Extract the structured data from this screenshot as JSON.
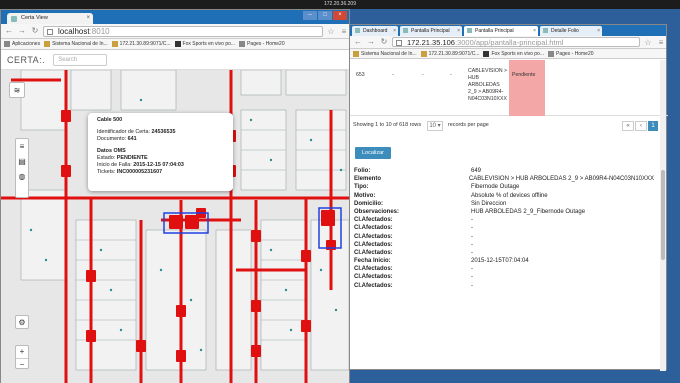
{
  "system": {
    "top_label": "172.20.36.209"
  },
  "left_window": {
    "tab_title": "Certa View",
    "url_host": "localhost",
    "url_port": ":8010",
    "bookmarks": [
      "Aplicaciones",
      "Sistema Nacional de In...",
      "172.21.30.89:9071/C...",
      "Fox Sports en vivo po...",
      "Pages - Home20"
    ],
    "app_logo": "CERTA:.",
    "search_placeholder": "Search",
    "popup": {
      "title": "Cable 500",
      "id_label": "Identificador de Certa:",
      "id_value": "24536535",
      "doc_label": "Documento:",
      "doc_value": "641",
      "section": "Datos OMS",
      "estado_label": "Estado:",
      "estado_value": "PENDIENTE",
      "inicio_label": "Inicio de Falla:",
      "inicio_value": "2015-12-15 07:04:03",
      "tickets_label": "Tickets:",
      "tickets_value": "INC000005231607"
    },
    "zoom_in": "+",
    "zoom_out": "−"
  },
  "right_window": {
    "tabs": [
      "Dashboard",
      "Pantalla Principal",
      "Pantalla Principal",
      "Detalle Folio"
    ],
    "url_host": "172.21.35.106",
    "url_path": ":3000/app/pantalla-principal.html",
    "bookmarks": [
      "Sistema Nacional de In...",
      "172.21.30.89:9071/C...",
      "Fox Sports en vivo po...",
      "Pages - Home20"
    ],
    "table_row": {
      "id": "653",
      "c2": "-",
      "c3": "-",
      "c4": "-",
      "element_lines": [
        "CABLEVISION >",
        "HUB",
        "ARBOLEDAS",
        "2_9 > AB09R4-",
        "N04C03N10XXX"
      ],
      "status": "Pendiente"
    },
    "pagination": {
      "showing": "Showing 1 to 10 of 618 rows",
      "per_page": "10",
      "per_page_suffix": "records per page",
      "prev": "‹",
      "first": "«",
      "page": "1"
    },
    "localizar_label": "Localizar",
    "details": [
      {
        "label": "Folio:",
        "value": "649"
      },
      {
        "label": "Elemento",
        "value": "CABLEVISION > HUB ARBOLEDAS 2_9 > AB09R4-N04C03N10XXX"
      },
      {
        "label": "Tipo:",
        "value": "Fibernode Outage"
      },
      {
        "label": "Motivo:",
        "value": "Absolute % of devices offline"
      },
      {
        "label": "Domicilio:",
        "value": "Sin Direccion"
      },
      {
        "label": "Observaciones:",
        "value": "HUB ARBOLEDAS 2_9_Fibernode Outage"
      },
      {
        "label": "Cl.Afectados:",
        "value": "-"
      },
      {
        "label": "Cl.Afectados:",
        "value": "-"
      },
      {
        "label": "Cl.Afectados:",
        "value": "-"
      },
      {
        "label": "Cl.Afectados:",
        "value": "-"
      },
      {
        "label": "Cl.Afectados:",
        "value": "-"
      },
      {
        "label": "Fecha Inicio:",
        "value": "2015-12-15T07:04:04"
      },
      {
        "label": "Cl.Afectados:",
        "value": "-"
      },
      {
        "label": "Cl.Afectados:",
        "value": "-"
      },
      {
        "label": "Cl.Afectados:",
        "value": "-"
      }
    ]
  }
}
